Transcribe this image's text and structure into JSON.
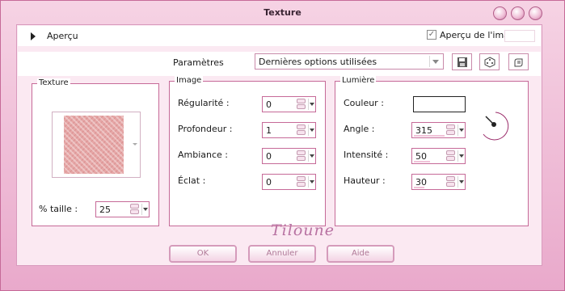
{
  "window": {
    "title": "Texture"
  },
  "apercu": {
    "label": "Aperçu",
    "checkbox_label": "Aperçu de l'image",
    "checked": true
  },
  "params": {
    "label": "Paramètres",
    "selected": "Dernières options utilisées"
  },
  "texture_group": {
    "title": "Texture",
    "size_label": "% taille :",
    "size_value": "25"
  },
  "image_group": {
    "title": "Image",
    "fields": [
      {
        "label": "Régularité :",
        "value": "0"
      },
      {
        "label": "Profondeur :",
        "value": "1"
      },
      {
        "label": "Ambiance :",
        "value": "0"
      },
      {
        "label": "Éclat :",
        "value": "0"
      }
    ]
  },
  "light_group": {
    "title": "Lumière",
    "color_label": "Couleur :",
    "fields": [
      {
        "label": "Angle :",
        "value": "315"
      },
      {
        "label": "Intensité :",
        "value": "50"
      },
      {
        "label": "Hauteur :",
        "value": "30"
      }
    ]
  },
  "buttons": {
    "ok": "OK",
    "cancel": "Annuler",
    "help": "Aide"
  },
  "signature": "Tiloune",
  "colors": {
    "accent": "#c66a98",
    "window_bg": "#f2c6dd",
    "panel_bg": "#fbe9f2",
    "texture": "#e6a6a6"
  }
}
